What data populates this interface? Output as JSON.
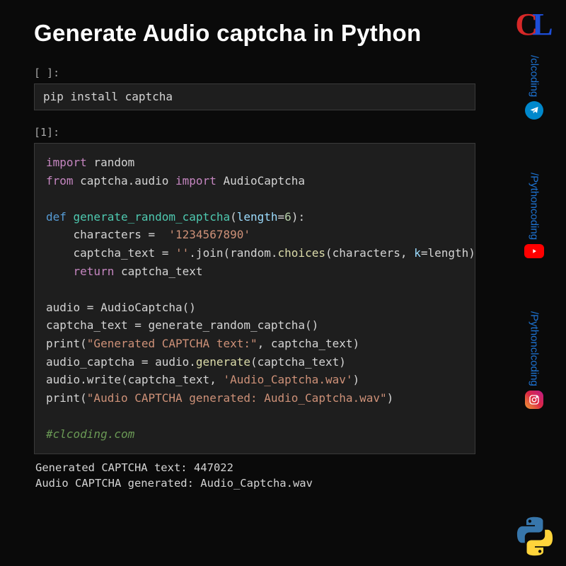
{
  "title": "Generate Audio captcha in Python",
  "cells": {
    "prompt0": "[ ]:",
    "code0": "pip install captcha",
    "prompt1": "[1]:",
    "code1_lines": {
      "l1a": "import",
      "l1b": " random",
      "l2a": "from",
      "l2b": " captcha.audio ",
      "l2c": "import",
      "l2d": " AudioCaptcha",
      "l4a": "def ",
      "l4b": "generate_random_captcha",
      "l4c": "(",
      "l4d": "length",
      "l4e": "=",
      "l4f": "6",
      "l4g": "):",
      "l5a": "    characters =  ",
      "l5b": "'1234567890'",
      "l6a": "    captcha_text = ",
      "l6b": "''",
      "l6c": ".join(random.",
      "l6d": "choices",
      "l6e": "(characters, ",
      "l6f": "k",
      "l6g": "=length))",
      "l7a": "    ",
      "l7b": "return",
      "l7c": " captcha_text",
      "l9a": "audio = AudioCaptcha()",
      "l10a": "captcha_text = generate_random_captcha()",
      "l11a": "print(",
      "l11b": "\"Generated CAPTCHA text:\"",
      "l11c": ", captcha_text)",
      "l12a": "audio_captcha = audio.",
      "l12b": "generate",
      "l12c": "(captcha_text)",
      "l13a": "audio.write(captcha_text, ",
      "l13b": "'Audio_Captcha.wav'",
      "l13c": ")",
      "l14a": "print(",
      "l14b": "\"Audio CAPTCHA generated: Audio_Captcha.wav\"",
      "l14c": ")",
      "l16": "#clcoding.com"
    }
  },
  "output": "Generated CAPTCHA text: 447022\nAudio CAPTCHA generated: Audio_Captcha.wav",
  "social": {
    "handle1": "/clcoding",
    "handle2": "/Pythoncoding",
    "handle3": "/Pythonclcoding"
  },
  "logo": {
    "c": "C",
    "l": "L"
  }
}
